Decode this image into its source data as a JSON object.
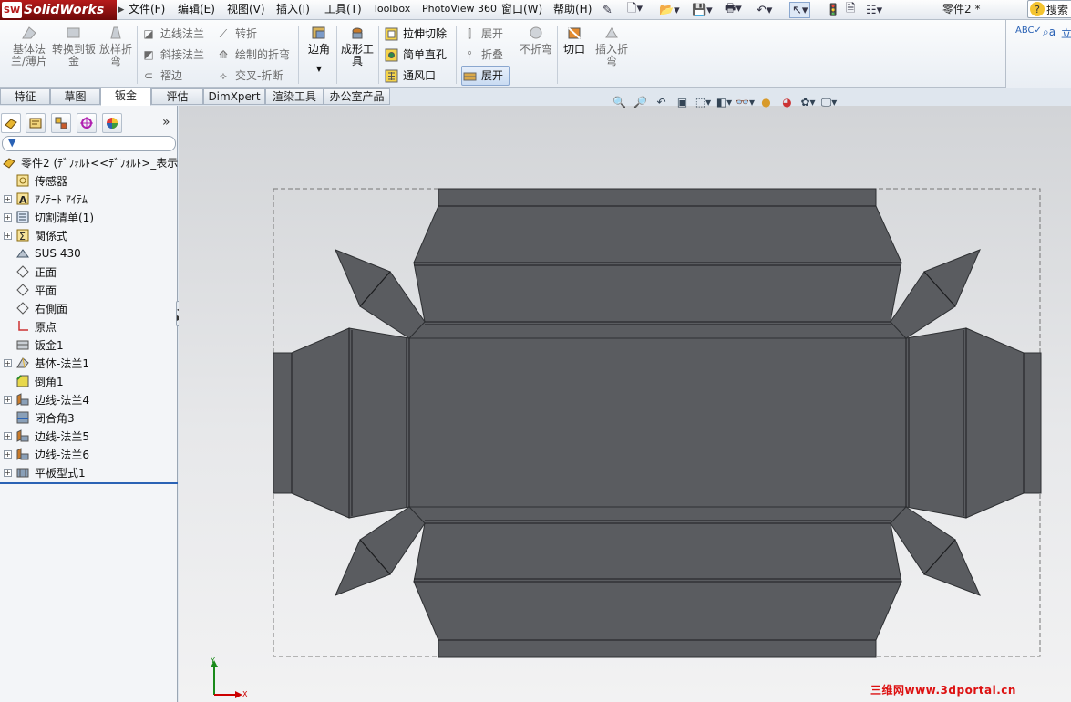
{
  "app": {
    "brand": "SolidWorks",
    "brand_badge": "SW",
    "document_title": "零件2 *",
    "search_label": "搜索"
  },
  "menu": {
    "items": [
      "文件(F)",
      "编辑(E)",
      "视图(V)",
      "插入(I)",
      "工具(T)",
      "Toolbox",
      "PhotoView 360",
      "窗口(W)",
      "帮助(H)"
    ]
  },
  "ribbon": {
    "base_flange": "基体法兰/薄片",
    "convert": "转换到钣金",
    "lofted_bend": "放样折弯",
    "edge_flange": "边线法兰",
    "miter_flange": "斜接法兰",
    "hem": "褶边",
    "jog": "转折",
    "sketched_bend": "绘制的折弯",
    "cross_break": "交叉-折断",
    "corners": "边角",
    "forming_tool": "成形工具",
    "extruded_cut": "拉伸切除",
    "simple_hole": "简单直孔",
    "vent": "通风口",
    "unfold": "展开",
    "fold": "折叠",
    "flatten": "展开",
    "no_bends": "不折弯",
    "rip": "切口",
    "insert_bends": "插入折弯"
  },
  "tabs": [
    "特征",
    "草图",
    "钣金",
    "评估",
    "DimXpert",
    "渲染工具",
    "办公室产品"
  ],
  "active_tab": "钣金",
  "tree": {
    "root": "零件2 (ﾃﾞﾌｫﾙﾄ<<ﾃﾞﾌｫﾙﾄ>_表示",
    "nodes": [
      {
        "label": "传感器",
        "expandable": false,
        "icon": "sensor-icon"
      },
      {
        "label": "ｱﾉﾃｰﾄ ｱｲﾃﾑ",
        "expandable": true,
        "icon": "annotation-icon"
      },
      {
        "label": "切割清单(1)",
        "expandable": true,
        "icon": "cut-list-icon"
      },
      {
        "label": "関係式",
        "expandable": true,
        "icon": "equations-icon"
      },
      {
        "label": "SUS 430",
        "expandable": false,
        "icon": "material-icon"
      },
      {
        "label": "正面",
        "expandable": false,
        "icon": "plane-icon"
      },
      {
        "label": "平面",
        "expandable": false,
        "icon": "plane-icon"
      },
      {
        "label": "右側面",
        "expandable": false,
        "icon": "plane-icon"
      },
      {
        "label": "原点",
        "expandable": false,
        "icon": "origin-icon"
      },
      {
        "label": "钣金1",
        "expandable": false,
        "icon": "sheet-metal-icon"
      },
      {
        "label": "基体-法兰1",
        "expandable": true,
        "icon": "base-flange-icon"
      },
      {
        "label": "倒角1",
        "expandable": false,
        "icon": "chamfer-icon"
      },
      {
        "label": "边线-法兰4",
        "expandable": true,
        "icon": "edge-flange-icon"
      },
      {
        "label": "闭合角3",
        "expandable": false,
        "icon": "closed-corner-icon"
      },
      {
        "label": "边线-法兰5",
        "expandable": true,
        "icon": "edge-flange-icon"
      },
      {
        "label": "边线-法兰6",
        "expandable": true,
        "icon": "edge-flange-icon"
      },
      {
        "label": "平板型式1",
        "expandable": true,
        "icon": "flat-pattern-icon"
      }
    ]
  },
  "triad": {
    "x": "X",
    "y": "Y"
  },
  "watermark": "三维网www.3dportal.cn",
  "colors": {
    "part": "#5a5c60",
    "part_edge": "#2e3033",
    "accent": "#2a62b5",
    "logo": "#b61b1b"
  }
}
